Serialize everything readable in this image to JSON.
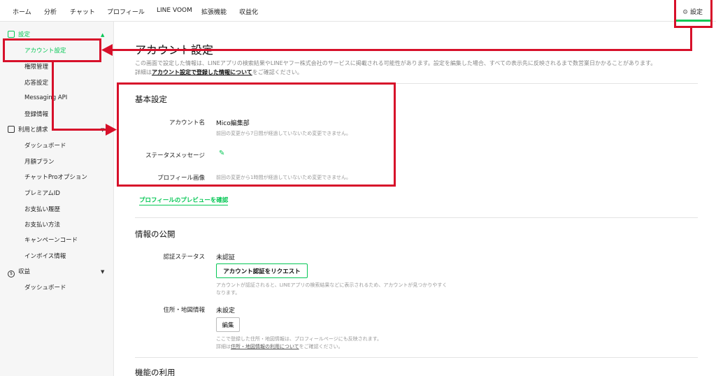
{
  "topnav": {
    "items": [
      "ホーム",
      "分析",
      "チャット",
      "プロフィール",
      "LINE VOOM",
      "拡張機能",
      "収益化"
    ],
    "settings_icon": "gear-icon",
    "settings_label": "設定"
  },
  "sidebar": {
    "sec_settings": "設定",
    "settings_items": [
      "アカウント設定",
      "権限管理",
      "応答設定",
      "Messaging API",
      "登録情報"
    ],
    "sec_usage": "利用と請求",
    "usage_items": [
      "ダッシュボード",
      "月額プラン",
      "チャットProオプション",
      "プレミアムID",
      "お支払い履歴",
      "お支払い方法",
      "キャンペーンコード",
      "インボイス情報"
    ],
    "sec_revenue": "収益",
    "revenue_icon_char": "$",
    "revenue_items": [
      "ダッシュボード"
    ]
  },
  "main": {
    "title": "アカウント設定",
    "desc_line1": "この画面で設定した情報は、LINEアプリの検索結果やLINEヤフー株式会社のサービスに掲載される可能性があります。設定を編集した場合、すべての表示先に反映されるまで数営業日かかることがあります。",
    "desc_line2_prefix": "詳細は",
    "desc_link": "アカウント設定で登録した情報について",
    "desc_line2_suffix": "をご確認ください。",
    "basic": {
      "title": "基本設定",
      "account_name_label": "アカウント名",
      "account_name_value": "Mico編集部",
      "account_name_note": "前回の変更から7日間が経過していないため変更できません。",
      "status_label": "ステータスメッセージ",
      "profile_image_label": "プロフィール画像",
      "profile_image_note": "前回の変更から1時間が経過していないため変更できません。",
      "preview_link": "プロフィールのプレビューを確認"
    },
    "publish": {
      "title": "情報の公開",
      "verify_label": "認証ステータス",
      "verify_value": "未認証",
      "verify_button": "アカウント認証をリクエスト",
      "verify_note_1": "アカウントが認証されると、LINEアプリの検索結果などに表示されるため、アカウントが見つかりやすく",
      "verify_note_2": "なります。",
      "address_label": "住所・地図情報",
      "address_value": "未設定",
      "edit_button": "編集",
      "address_note_1": "ここで登録した住所・地図情報は、プロフィールページにも反映されます。",
      "address_note_2_prefix": "詳細は",
      "address_note_link": "住所・地図情報の利用について",
      "address_note_2_suffix": "をご確認ください。"
    },
    "features_title": "機能の利用"
  },
  "colors": {
    "accent": "#06c755",
    "annotation": "#d7102a"
  }
}
